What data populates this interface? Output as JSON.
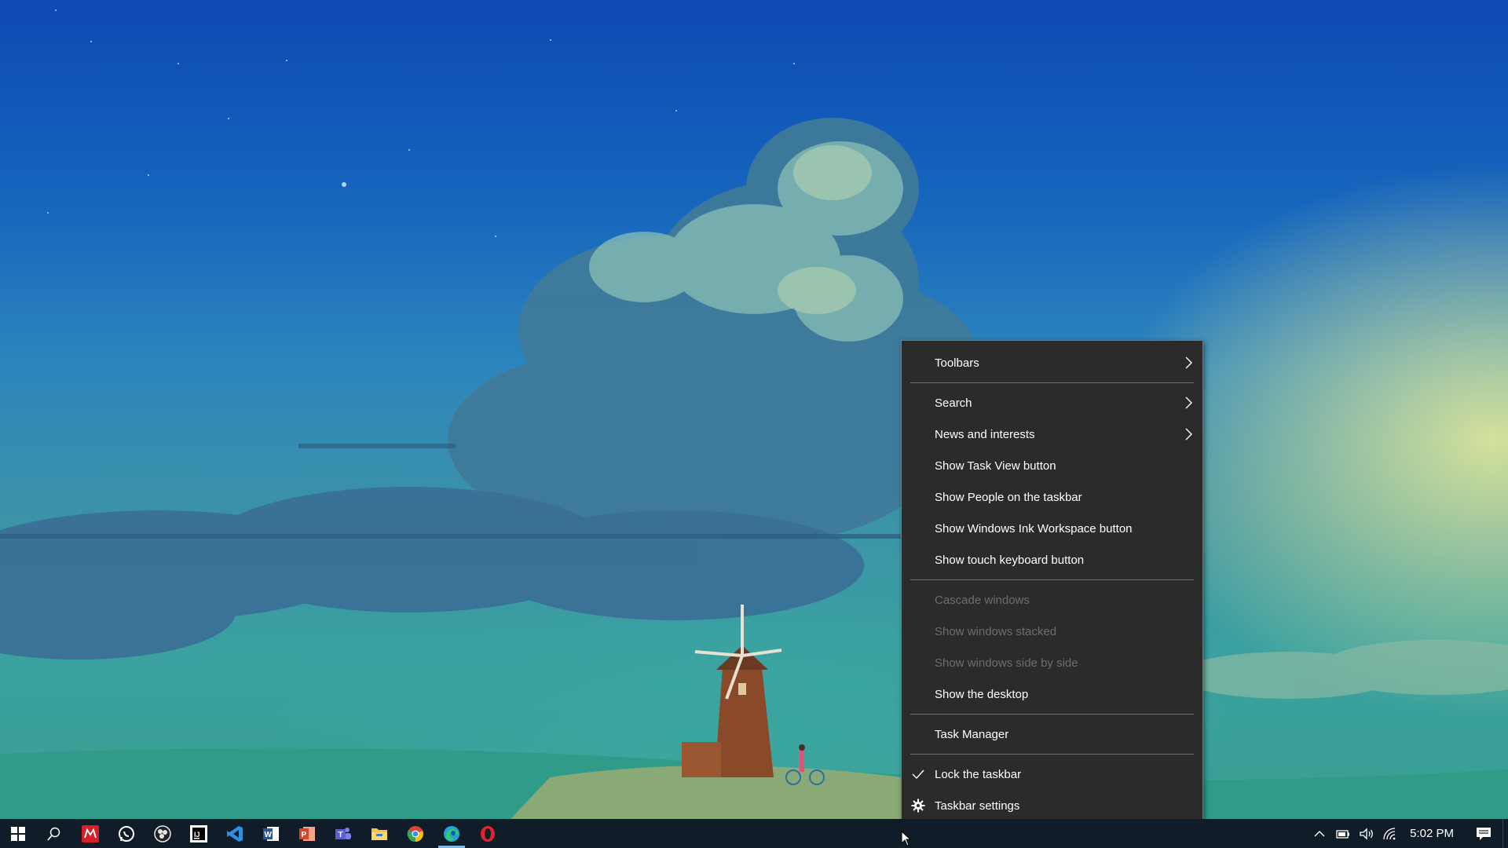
{
  "context_menu": {
    "groups": [
      [
        {
          "label": "Toolbars",
          "submenu": true,
          "enabled": true
        }
      ],
      [
        {
          "label": "Search",
          "submenu": true,
          "enabled": true
        },
        {
          "label": "News and interests",
          "submenu": true,
          "enabled": true
        },
        {
          "label": "Show Task View button",
          "submenu": false,
          "enabled": true
        },
        {
          "label": "Show People on the taskbar",
          "submenu": false,
          "enabled": true
        },
        {
          "label": "Show Windows Ink Workspace button",
          "submenu": false,
          "enabled": true
        },
        {
          "label": "Show touch keyboard button",
          "submenu": false,
          "enabled": true
        }
      ],
      [
        {
          "label": "Cascade windows",
          "submenu": false,
          "enabled": false
        },
        {
          "label": "Show windows stacked",
          "submenu": false,
          "enabled": false
        },
        {
          "label": "Show windows side by side",
          "submenu": false,
          "enabled": false
        },
        {
          "label": "Show the desktop",
          "submenu": false,
          "enabled": true
        }
      ],
      [
        {
          "label": "Task Manager",
          "submenu": false,
          "enabled": true
        }
      ],
      [
        {
          "label": "Lock the taskbar",
          "submenu": false,
          "enabled": true,
          "checked": true,
          "icon": "checkmark-icon"
        },
        {
          "label": "Taskbar settings",
          "submenu": false,
          "enabled": true,
          "icon": "gear-icon"
        }
      ]
    ]
  },
  "taskbar": {
    "pinned": [
      {
        "name": "start-button",
        "icon": "windows-logo-icon"
      },
      {
        "name": "search-button",
        "icon": "search-icon"
      },
      {
        "name": "mendeley-app",
        "icon": "mendeley-icon",
        "color": "#d71e29"
      },
      {
        "name": "whatsapp-app",
        "icon": "whatsapp-icon",
        "color": "#25d366"
      },
      {
        "name": "obs-app",
        "icon": "obs-icon",
        "color": "#e6e6e6"
      },
      {
        "name": "intellij-app",
        "icon": "intellij-icon",
        "color": "#000000"
      },
      {
        "name": "vscode-app",
        "icon": "vscode-icon",
        "color": "#2f8fe0"
      },
      {
        "name": "word-app",
        "icon": "word-icon",
        "color": "#2b5797"
      },
      {
        "name": "powerpoint-app",
        "icon": "powerpoint-icon",
        "color": "#d24726"
      },
      {
        "name": "teams-app",
        "icon": "teams-icon",
        "color": "#5b5fc7"
      },
      {
        "name": "file-explorer-app",
        "icon": "folder-icon",
        "color": "#f4c542"
      },
      {
        "name": "chrome-app",
        "icon": "chrome-icon",
        "color": "#34a853"
      },
      {
        "name": "edge-app",
        "icon": "edge-icon",
        "color": "#1fa3d9",
        "active": true
      },
      {
        "name": "opera-app",
        "icon": "opera-icon",
        "color": "#e0242f"
      }
    ],
    "tray": {
      "icons": [
        "chevron-up-icon",
        "battery-icon",
        "volume-icon",
        "wifi-icon"
      ],
      "clock": "5:02 PM",
      "notification_icon": "action-center-icon"
    }
  },
  "colors": {
    "menu_bg": "#2b2b2b",
    "menu_border": "#7a7a7a",
    "taskbar_bg": "#101d28",
    "disabled_text": "#6d6d6d",
    "active_indicator": "#76b9ed"
  }
}
